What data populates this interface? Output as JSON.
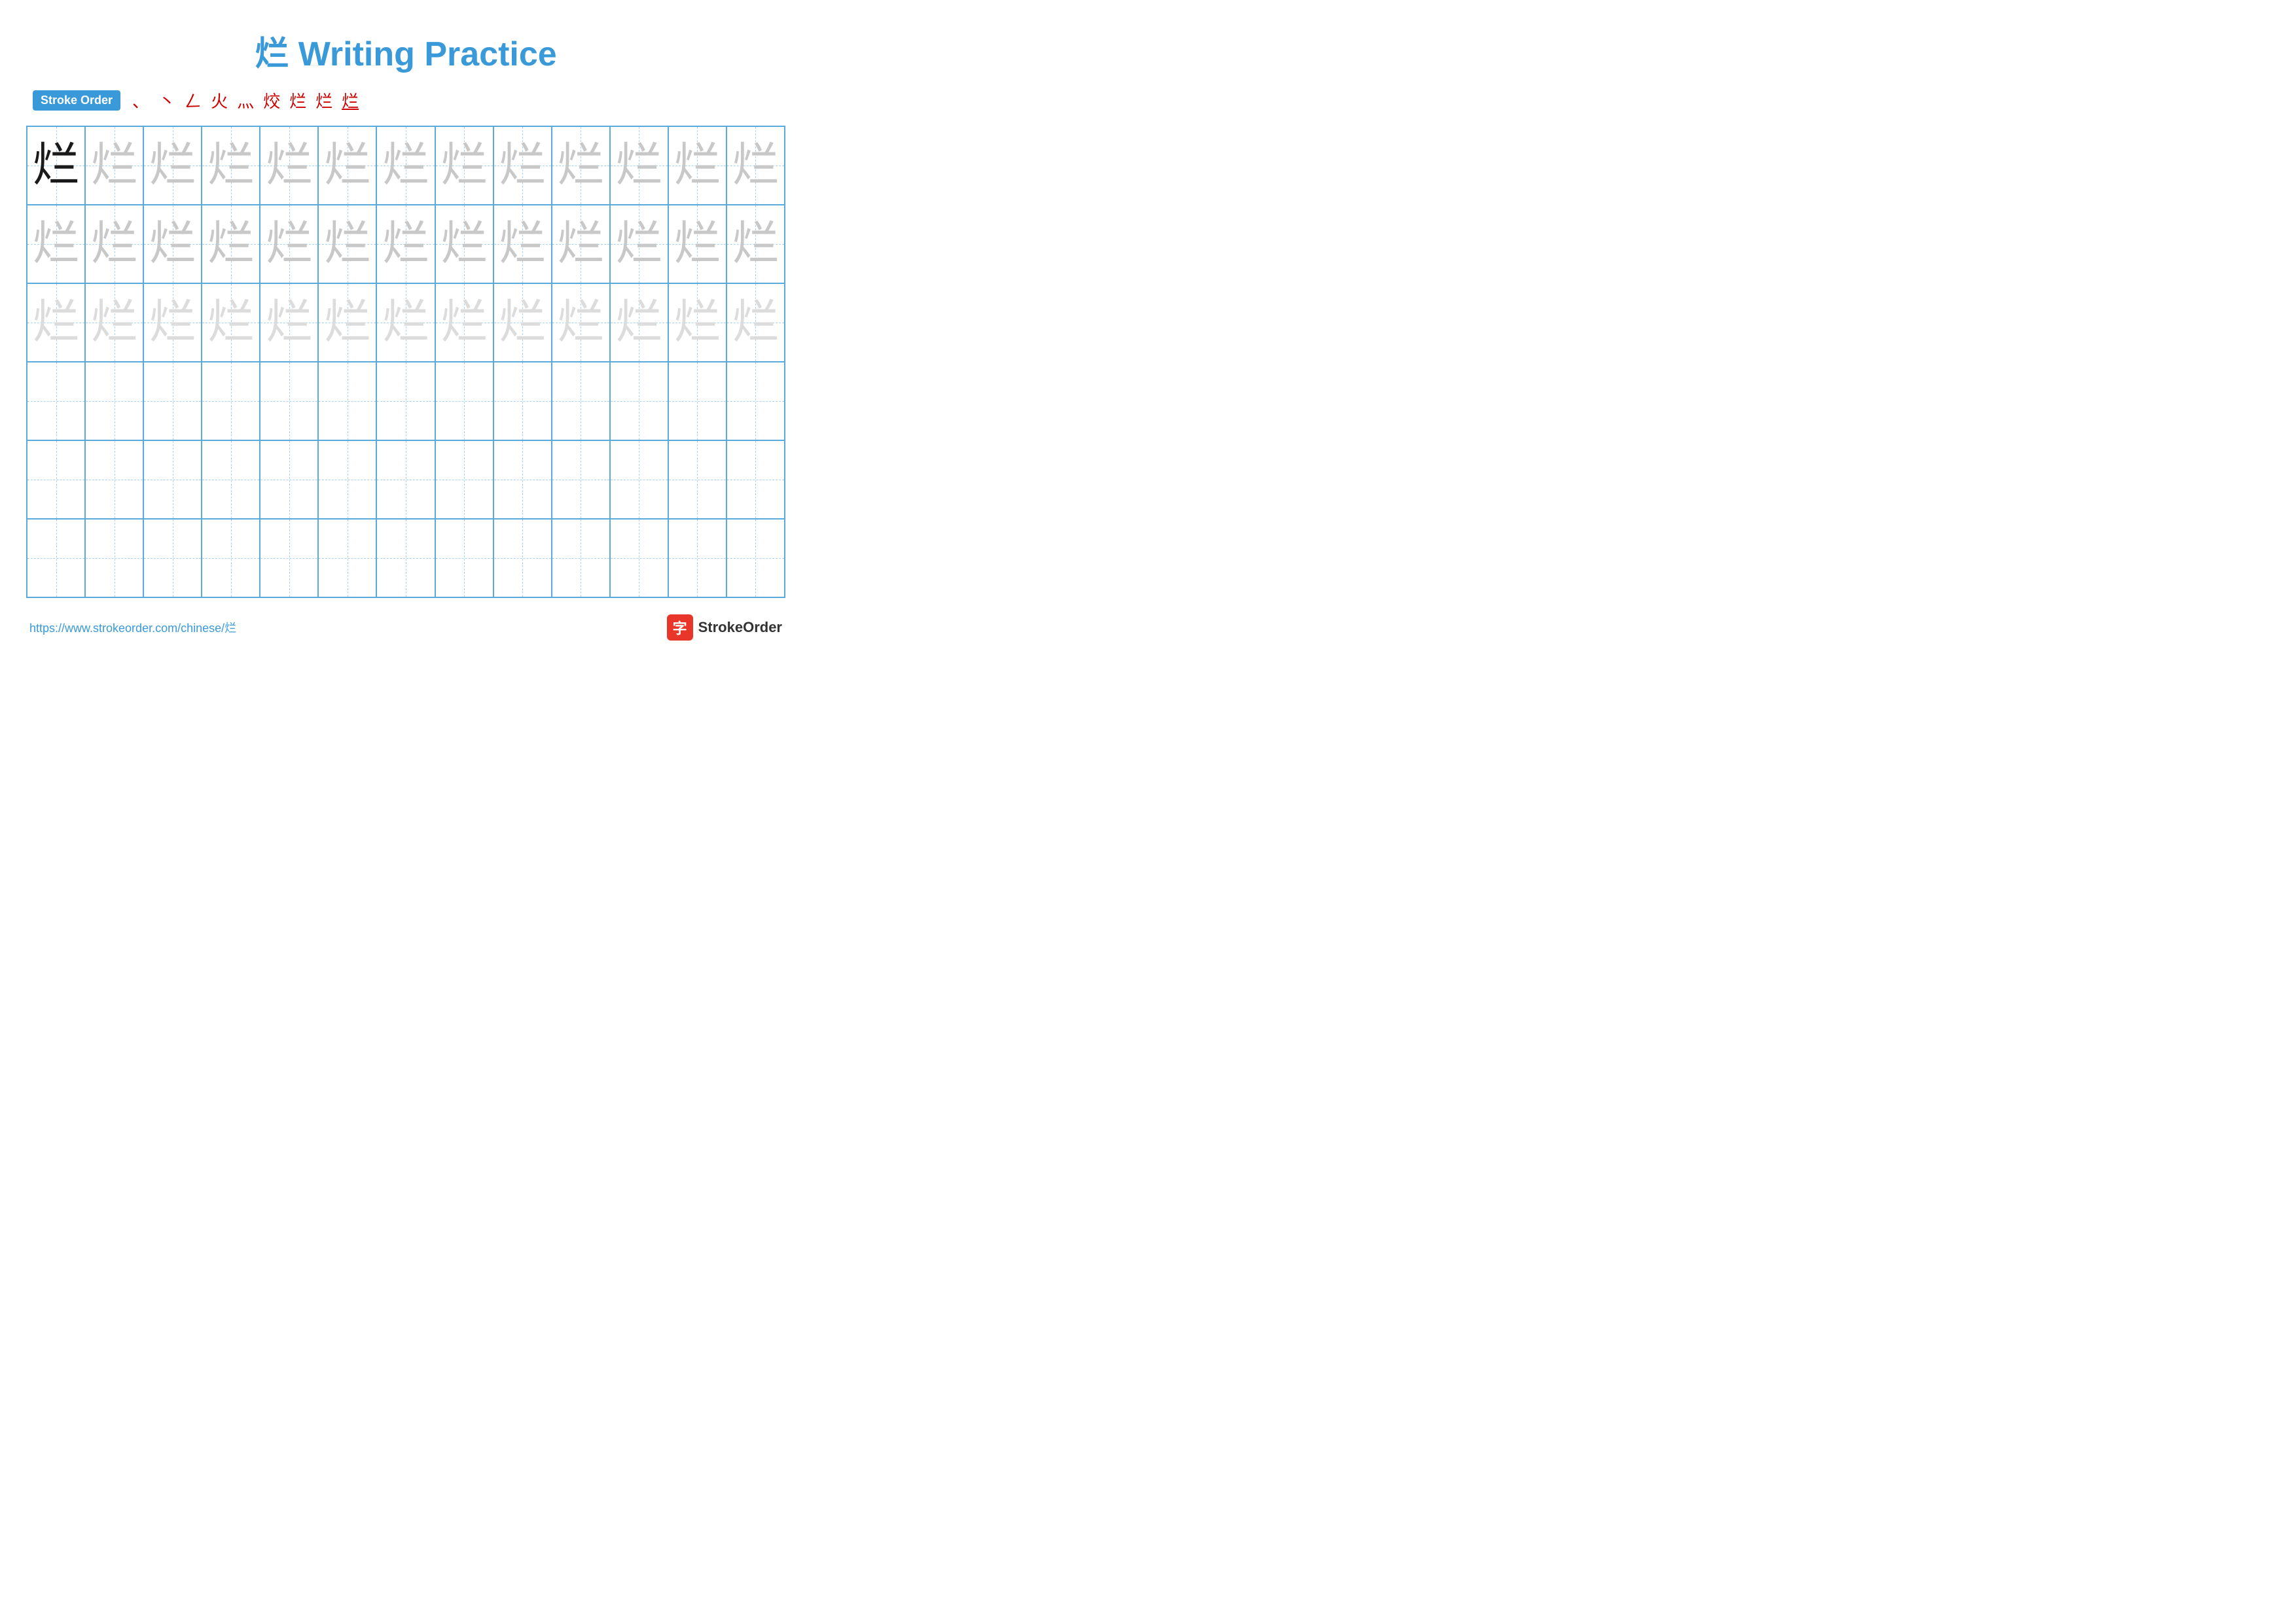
{
  "title": {
    "character": "烂",
    "text": "烂 Writing Practice"
  },
  "stroke_order": {
    "badge_label": "Stroke Order",
    "strokes": [
      "、",
      "、",
      "㇏",
      "火",
      "炏",
      "炏'",
      "烂-",
      "烂=",
      "烂"
    ]
  },
  "grid": {
    "cols": 13,
    "rows": 6,
    "character": "烂"
  },
  "footer": {
    "url": "https://www.strokeorder.com/chinese/烂",
    "brand": "StrokeOrder",
    "logo_char": "字"
  }
}
